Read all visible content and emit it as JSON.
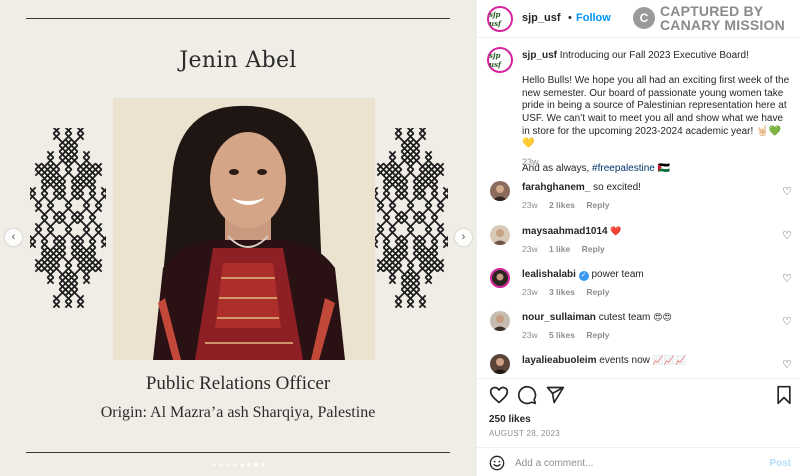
{
  "post_image": {
    "name_title": "Jenin Abel",
    "role": "Public Relations Officer",
    "origin": "Origin: Al Mazra’a ash Sharqiya, Palestine",
    "slide_count": 8,
    "active_slide": 7
  },
  "header": {
    "username": "sjp_usf",
    "separator": "•",
    "follow_label": "Follow",
    "avatar_text": "sjp usf"
  },
  "watermark": {
    "line1": "CAPTURED BY",
    "line2": "CANARY MISSION",
    "badge": "C"
  },
  "caption": {
    "username": "sjp_usf",
    "intro": "Introducing our Fall 2023 Executive Board!",
    "body": "Hello Bulls! We hope you all had an exciting first week of the new semester. Our board of passionate young women take pride in being a source of Palestinian representation here at USF. We can’t wait to meet you all and show what we have in store for the upcoming 2023-2024 academic year! 🤘🏻💚💛",
    "closing": "And as always,",
    "hashtag": "#freepalestine",
    "closing_emoji": "🇵🇸",
    "time": "23w"
  },
  "comments": [
    {
      "username": "farahghanem_",
      "text": "so excited!",
      "emoji": "",
      "verified": false,
      "time": "23w",
      "likes": "2 likes",
      "reply": "Reply"
    },
    {
      "username": "maysaahmad1014",
      "text": "",
      "emoji": "❤️",
      "verified": false,
      "time": "23w",
      "likes": "1 like",
      "reply": "Reply"
    },
    {
      "username": "lealishalabi",
      "text": "power team",
      "emoji": "",
      "verified": true,
      "time": "23w",
      "likes": "3 likes",
      "reply": "Reply"
    },
    {
      "username": "nour_sullaiman",
      "text": "cutest team",
      "emoji": "😍😍",
      "verified": false,
      "time": "23w",
      "likes": "5 likes",
      "reply": "Reply"
    },
    {
      "username": "layalieabuoleim",
      "text": "events now",
      "emoji": "📈📈📈",
      "verified": false,
      "time": "",
      "likes": "",
      "reply": ""
    }
  ],
  "actions": {
    "likes": "250 likes",
    "date": "AUGUST 28, 2023",
    "comment_placeholder": "Add a comment...",
    "post_label": "Post"
  },
  "colors": {
    "follow_blue": "#0095f6",
    "story_ring": "#d6249f",
    "verified_blue": "#3897f0",
    "post_disabled": "#b2dffc",
    "image_background": "#f0ede6"
  },
  "icons": [
    "heart-icon",
    "comment-icon",
    "share-icon",
    "bookmark-icon",
    "smile-icon",
    "chevron-left-icon",
    "chevron-right-icon",
    "verified-icon"
  ]
}
